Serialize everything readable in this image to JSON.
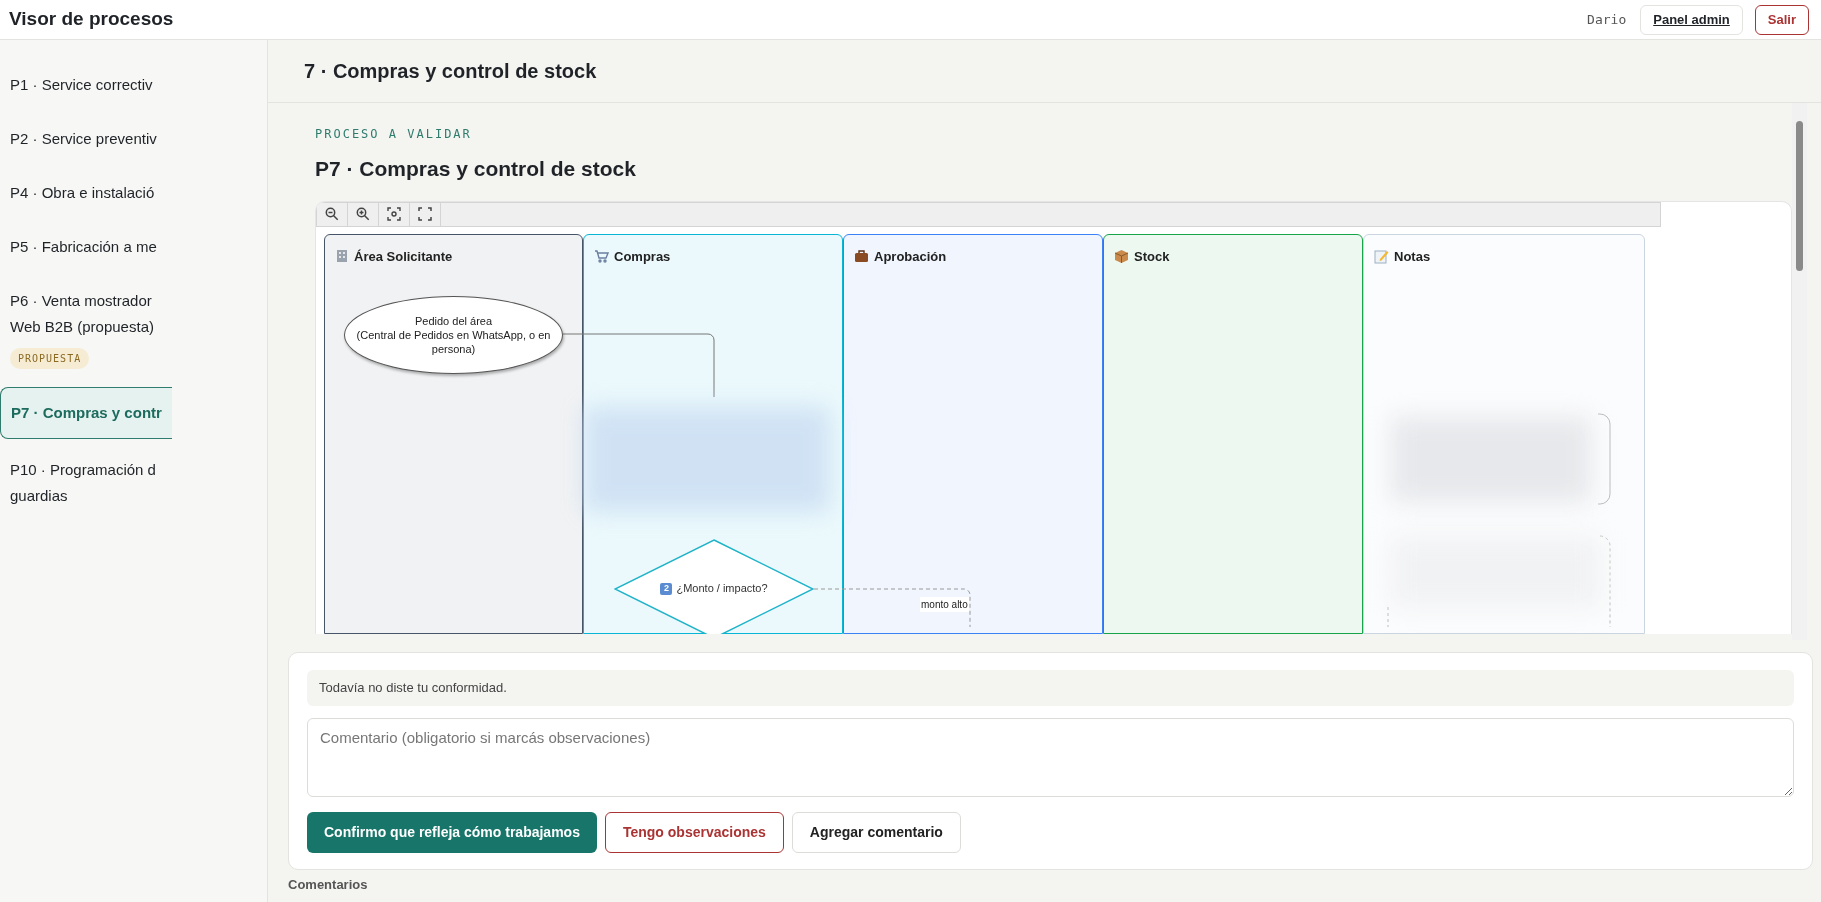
{
  "header": {
    "title": "Visor de procesos",
    "user": "Dario",
    "buttons": [
      {
        "label": "Panel admin",
        "kind": "link"
      },
      {
        "label": "Salir",
        "kind": "danger"
      }
    ]
  },
  "sidebar": {
    "items": [
      {
        "lines": [
          "P1 · Service correctiv"
        ],
        "selected": false
      },
      {
        "lines": [
          "P2 · Service preventiv"
        ],
        "selected": false
      },
      {
        "lines": [
          "P4 · Obra e instalació"
        ],
        "selected": false
      },
      {
        "lines": [
          "P5 · Fabricación a me"
        ],
        "selected": false
      },
      {
        "lines": [
          "P6 · Venta mostrador",
          "Web B2B (propuesta)"
        ],
        "badge": "PROPUESTA",
        "selected": false
      },
      {
        "lines": [
          "P7 · Compras y contr"
        ],
        "selected": true
      },
      {
        "lines": [
          "P10 · Programación d",
          "guardias"
        ],
        "selected": false
      }
    ]
  },
  "page_title": "7 · Compras y control de stock",
  "eyebrow": "PROCESO A VALIDAR",
  "process_title": "P7 · Compras y control de stock",
  "diagram": {
    "lanes": [
      {
        "name": "Área Solicitante",
        "color": "#475569"
      },
      {
        "name": "Compras",
        "color": "#06b6d4"
      },
      {
        "name": "Aprobación",
        "color": "#3b82f6"
      },
      {
        "name": "Stock",
        "color": "#16a34a"
      },
      {
        "name": "Notas",
        "color": "#cbd5e1"
      }
    ],
    "start_node": {
      "lines": [
        "Pedido del área",
        "(Central de Pedidos en WhatsApp, o en",
        "persona)"
      ]
    },
    "decision": {
      "badge": "2",
      "text": "¿Monto / impacto?"
    },
    "edge_label": "monto alto"
  },
  "validation": {
    "status": "Todavía no diste tu conformidad.",
    "comment": {
      "placeholder": "Comentario (obligatorio si marcás observaciones)"
    },
    "buttons": [
      {
        "label": "Confirmo que refleja cómo trabajamos",
        "kind": "primary"
      },
      {
        "label": "Tengo observaciones",
        "kind": "danger"
      },
      {
        "label": "Agregar comentario",
        "kind": "plain"
      }
    ]
  },
  "comments_heading": "Comentarios"
}
